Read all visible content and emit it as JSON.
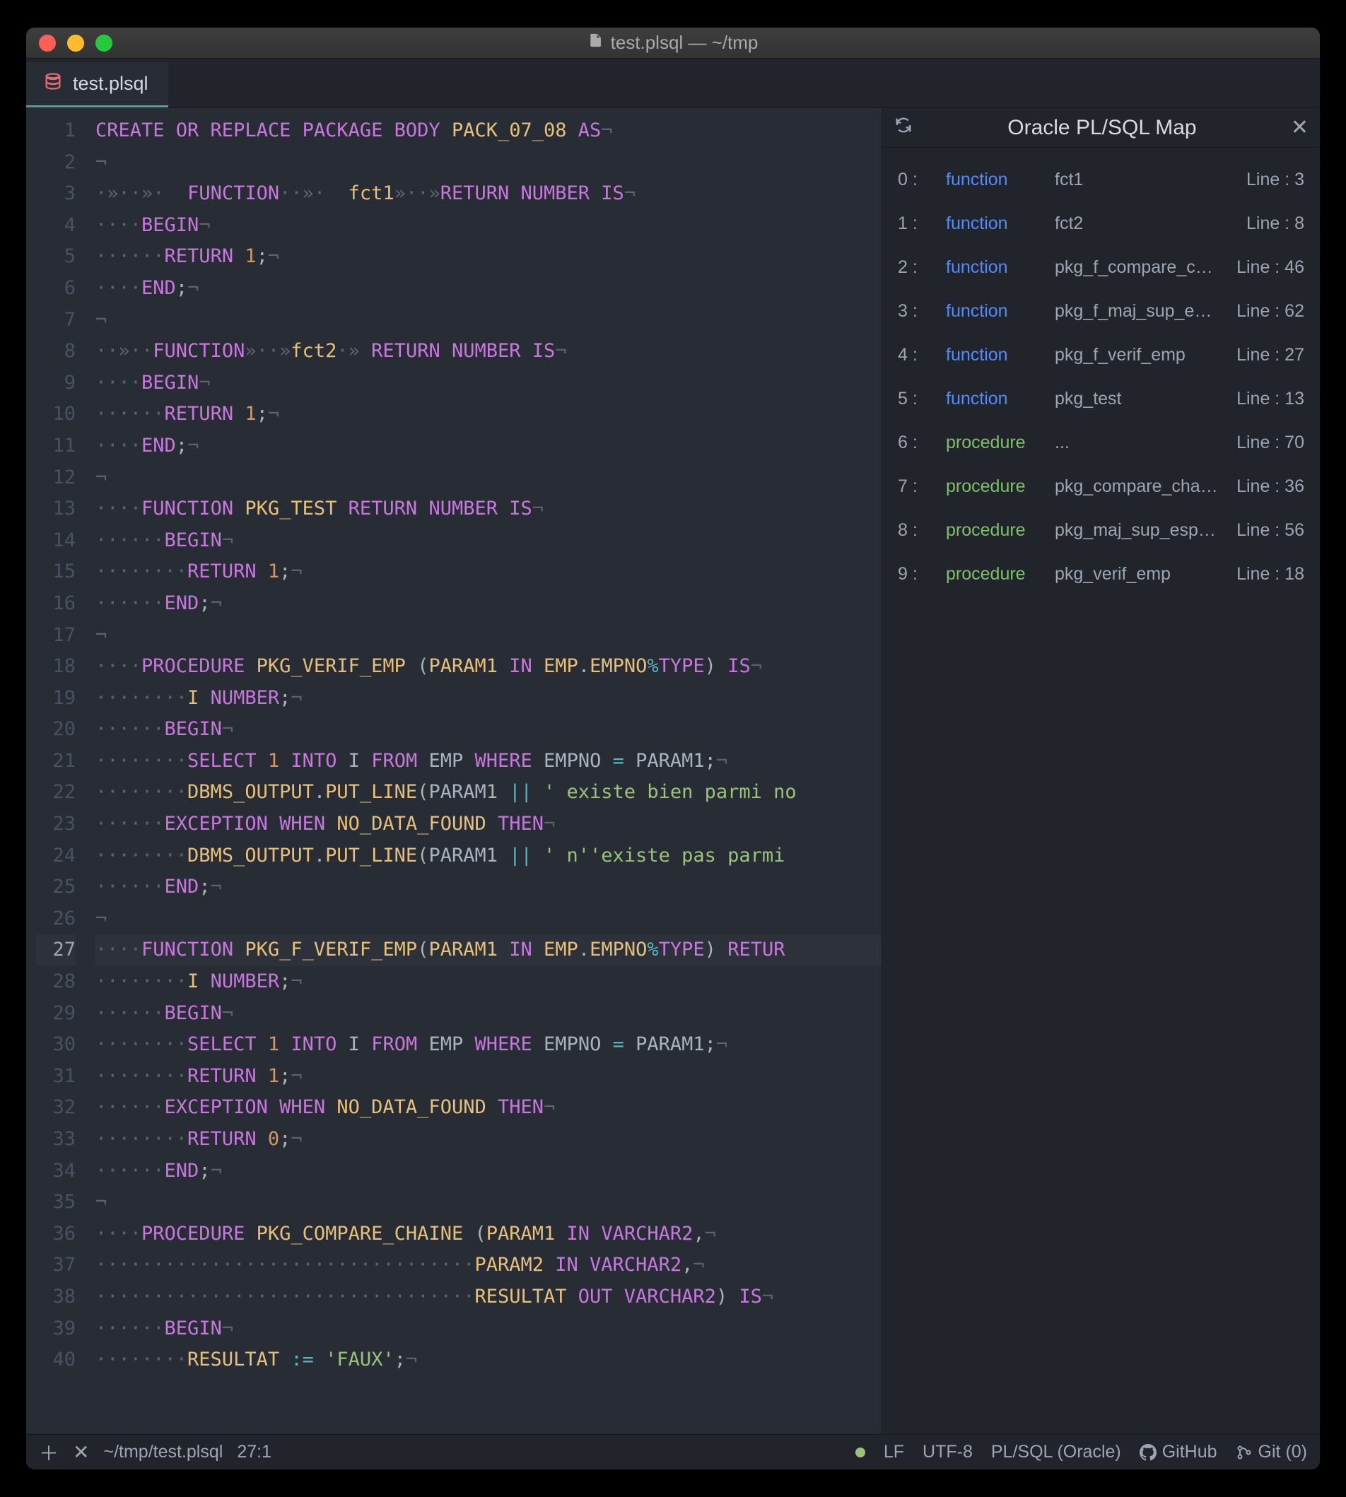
{
  "window": {
    "title": "test.plsql — ~/tmp"
  },
  "tab": {
    "name": "test.plsql"
  },
  "gutter": {
    "start": 1,
    "end": 40,
    "active": 27
  },
  "code": [
    {
      "t": [
        [
          "kw",
          "CREATE OR REPLACE PACKAGE BODY"
        ],
        [
          "plain",
          " "
        ],
        [
          "ident",
          "PACK_07_08"
        ],
        [
          "plain",
          " "
        ],
        [
          "kw",
          "AS"
        ],
        [
          "inv",
          "¬"
        ]
      ]
    },
    {
      "t": [
        [
          "inv",
          "¬"
        ]
      ]
    },
    {
      "t": [
        [
          "inv",
          "·»··»·"
        ],
        [
          "plain",
          "  "
        ],
        [
          "kw",
          "FUNCTION"
        ],
        [
          "inv",
          "··»·"
        ],
        [
          "plain",
          "  "
        ],
        [
          "ident",
          "fct1"
        ],
        [
          "inv",
          "»··»"
        ],
        [
          "kw",
          "RETURN NUMBER IS"
        ],
        [
          "inv",
          "¬"
        ]
      ]
    },
    {
      "t": [
        [
          "inv",
          "····"
        ],
        [
          "kw",
          "BEGIN"
        ],
        [
          "inv",
          "¬"
        ]
      ]
    },
    {
      "t": [
        [
          "inv",
          "······"
        ],
        [
          "kw",
          "RETURN"
        ],
        [
          "plain",
          " "
        ],
        [
          "num",
          "1"
        ],
        [
          "punct",
          ";"
        ],
        [
          "inv",
          "¬"
        ]
      ]
    },
    {
      "t": [
        [
          "inv",
          "····"
        ],
        [
          "kw",
          "END"
        ],
        [
          "punct",
          ";"
        ],
        [
          "inv",
          "¬"
        ]
      ]
    },
    {
      "t": [
        [
          "inv",
          "¬"
        ]
      ]
    },
    {
      "t": [
        [
          "inv",
          "··»··"
        ],
        [
          "kw",
          "FUNCTION"
        ],
        [
          "inv",
          "»··»"
        ],
        [
          "ident",
          "fct2"
        ],
        [
          "inv",
          "·»"
        ],
        [
          "plain",
          " "
        ],
        [
          "kw",
          "RETURN NUMBER IS"
        ],
        [
          "inv",
          "¬"
        ]
      ]
    },
    {
      "t": [
        [
          "inv",
          "····"
        ],
        [
          "kw",
          "BEGIN"
        ],
        [
          "inv",
          "¬"
        ]
      ]
    },
    {
      "t": [
        [
          "inv",
          "······"
        ],
        [
          "kw",
          "RETURN"
        ],
        [
          "plain",
          " "
        ],
        [
          "num",
          "1"
        ],
        [
          "punct",
          ";"
        ],
        [
          "inv",
          "¬"
        ]
      ]
    },
    {
      "t": [
        [
          "inv",
          "····"
        ],
        [
          "kw",
          "END"
        ],
        [
          "punct",
          ";"
        ],
        [
          "inv",
          "¬"
        ]
      ]
    },
    {
      "t": [
        [
          "inv",
          "¬"
        ]
      ]
    },
    {
      "t": [
        [
          "inv",
          "····"
        ],
        [
          "kw",
          "FUNCTION"
        ],
        [
          "plain",
          " "
        ],
        [
          "ident",
          "PKG_TEST"
        ],
        [
          "plain",
          " "
        ],
        [
          "kw",
          "RETURN NUMBER IS"
        ],
        [
          "inv",
          "¬"
        ]
      ]
    },
    {
      "t": [
        [
          "inv",
          "······"
        ],
        [
          "kw",
          "BEGIN"
        ],
        [
          "inv",
          "¬"
        ]
      ]
    },
    {
      "t": [
        [
          "inv",
          "········"
        ],
        [
          "kw",
          "RETURN"
        ],
        [
          "plain",
          " "
        ],
        [
          "num",
          "1"
        ],
        [
          "punct",
          ";"
        ],
        [
          "inv",
          "¬"
        ]
      ]
    },
    {
      "t": [
        [
          "inv",
          "······"
        ],
        [
          "kw",
          "END"
        ],
        [
          "punct",
          ";"
        ],
        [
          "inv",
          "¬"
        ]
      ]
    },
    {
      "t": [
        [
          "inv",
          "¬"
        ]
      ]
    },
    {
      "t": [
        [
          "inv",
          "····"
        ],
        [
          "kw",
          "PROCEDURE"
        ],
        [
          "plain",
          " "
        ],
        [
          "ident",
          "PKG_VERIF_EMP"
        ],
        [
          "plain",
          " ("
        ],
        [
          "ident",
          "PARAM1"
        ],
        [
          "plain",
          " "
        ],
        [
          "kw",
          "IN"
        ],
        [
          "plain",
          " "
        ],
        [
          "ident",
          "EMP"
        ],
        [
          "punct",
          "."
        ],
        [
          "ident",
          "EMPNO"
        ],
        [
          "op",
          "%"
        ],
        [
          "kw",
          "TYPE"
        ],
        [
          "punct",
          ")"
        ],
        [
          "plain",
          " "
        ],
        [
          "kw",
          "IS"
        ],
        [
          "inv",
          "¬"
        ]
      ]
    },
    {
      "t": [
        [
          "inv",
          "········"
        ],
        [
          "ident",
          "I"
        ],
        [
          "plain",
          " "
        ],
        [
          "kw",
          "NUMBER"
        ],
        [
          "punct",
          ";"
        ],
        [
          "inv",
          "¬"
        ]
      ]
    },
    {
      "t": [
        [
          "inv",
          "······"
        ],
        [
          "kw",
          "BEGIN"
        ],
        [
          "inv",
          "¬"
        ]
      ]
    },
    {
      "t": [
        [
          "inv",
          "········"
        ],
        [
          "kw",
          "SELECT"
        ],
        [
          "plain",
          " "
        ],
        [
          "num",
          "1"
        ],
        [
          "plain",
          " "
        ],
        [
          "kw",
          "INTO"
        ],
        [
          "plain",
          " I "
        ],
        [
          "kw",
          "FROM"
        ],
        [
          "plain",
          " EMP "
        ],
        [
          "kw",
          "WHERE"
        ],
        [
          "plain",
          " EMPNO "
        ],
        [
          "op",
          "="
        ],
        [
          "plain",
          " PARAM1"
        ],
        [
          "punct",
          ";"
        ],
        [
          "inv",
          "¬"
        ]
      ]
    },
    {
      "t": [
        [
          "inv",
          "········"
        ],
        [
          "ident",
          "DBMS_OUTPUT"
        ],
        [
          "punct",
          "."
        ],
        [
          "ident",
          "PUT_LINE"
        ],
        [
          "punct",
          "("
        ],
        [
          "plain",
          "PARAM1 "
        ],
        [
          "op",
          "||"
        ],
        [
          "plain",
          " "
        ],
        [
          "str",
          "' existe bien parmi no"
        ]
      ]
    },
    {
      "t": [
        [
          "inv",
          "······"
        ],
        [
          "kw",
          "EXCEPTION WHEN"
        ],
        [
          "plain",
          " "
        ],
        [
          "ident",
          "NO_DATA_FOUND"
        ],
        [
          "plain",
          " "
        ],
        [
          "kw",
          "THEN"
        ],
        [
          "inv",
          "¬"
        ]
      ]
    },
    {
      "t": [
        [
          "inv",
          "········"
        ],
        [
          "ident",
          "DBMS_OUTPUT"
        ],
        [
          "punct",
          "."
        ],
        [
          "ident",
          "PUT_LINE"
        ],
        [
          "punct",
          "("
        ],
        [
          "plain",
          "PARAM1 "
        ],
        [
          "op",
          "||"
        ],
        [
          "plain",
          " "
        ],
        [
          "str",
          "' n''existe pas parmi "
        ]
      ]
    },
    {
      "t": [
        [
          "inv",
          "······"
        ],
        [
          "kw",
          "END"
        ],
        [
          "punct",
          ";"
        ],
        [
          "inv",
          "¬"
        ]
      ]
    },
    {
      "t": [
        [
          "inv",
          "¬"
        ]
      ]
    },
    {
      "t": [
        [
          "inv",
          "····"
        ],
        [
          "kw",
          "FUNCTION"
        ],
        [
          "plain",
          " "
        ],
        [
          "ident",
          "PKG_F_VERIF_EMP"
        ],
        [
          "punct",
          "("
        ],
        [
          "ident",
          "PARAM1"
        ],
        [
          "plain",
          " "
        ],
        [
          "kw",
          "IN"
        ],
        [
          "plain",
          " "
        ],
        [
          "ident",
          "EMP"
        ],
        [
          "punct",
          "."
        ],
        [
          "ident",
          "EMPNO"
        ],
        [
          "op",
          "%"
        ],
        [
          "kw",
          "TYPE"
        ],
        [
          "punct",
          ")"
        ],
        [
          "plain",
          " "
        ],
        [
          "kw",
          "RETUR"
        ]
      ],
      "active": true
    },
    {
      "t": [
        [
          "inv",
          "········"
        ],
        [
          "ident",
          "I"
        ],
        [
          "plain",
          " "
        ],
        [
          "kw",
          "NUMBER"
        ],
        [
          "punct",
          ";"
        ],
        [
          "inv",
          "¬"
        ]
      ]
    },
    {
      "t": [
        [
          "inv",
          "······"
        ],
        [
          "kw",
          "BEGIN"
        ],
        [
          "inv",
          "¬"
        ]
      ]
    },
    {
      "t": [
        [
          "inv",
          "········"
        ],
        [
          "kw",
          "SELECT"
        ],
        [
          "plain",
          " "
        ],
        [
          "num",
          "1"
        ],
        [
          "plain",
          " "
        ],
        [
          "kw",
          "INTO"
        ],
        [
          "plain",
          " I "
        ],
        [
          "kw",
          "FROM"
        ],
        [
          "plain",
          " EMP "
        ],
        [
          "kw",
          "WHERE"
        ],
        [
          "plain",
          " EMPNO "
        ],
        [
          "op",
          "="
        ],
        [
          "plain",
          " PARAM1"
        ],
        [
          "punct",
          ";"
        ],
        [
          "inv",
          "¬"
        ]
      ]
    },
    {
      "t": [
        [
          "inv",
          "········"
        ],
        [
          "kw",
          "RETURN"
        ],
        [
          "plain",
          " "
        ],
        [
          "num",
          "1"
        ],
        [
          "punct",
          ";"
        ],
        [
          "inv",
          "¬"
        ]
      ]
    },
    {
      "t": [
        [
          "inv",
          "······"
        ],
        [
          "kw",
          "EXCEPTION WHEN"
        ],
        [
          "plain",
          " "
        ],
        [
          "ident",
          "NO_DATA_FOUND"
        ],
        [
          "plain",
          " "
        ],
        [
          "kw",
          "THEN"
        ],
        [
          "inv",
          "¬"
        ]
      ]
    },
    {
      "t": [
        [
          "inv",
          "········"
        ],
        [
          "kw",
          "RETURN"
        ],
        [
          "plain",
          " "
        ],
        [
          "num",
          "0"
        ],
        [
          "punct",
          ";"
        ],
        [
          "inv",
          "¬"
        ]
      ]
    },
    {
      "t": [
        [
          "inv",
          "······"
        ],
        [
          "kw",
          "END"
        ],
        [
          "punct",
          ";"
        ],
        [
          "inv",
          "¬"
        ]
      ]
    },
    {
      "t": [
        [
          "inv",
          "¬"
        ]
      ]
    },
    {
      "t": [
        [
          "inv",
          "····"
        ],
        [
          "kw",
          "PROCEDURE"
        ],
        [
          "plain",
          " "
        ],
        [
          "ident",
          "PKG_COMPARE_CHAINE"
        ],
        [
          "plain",
          " ("
        ],
        [
          "ident",
          "PARAM1"
        ],
        [
          "plain",
          " "
        ],
        [
          "kw",
          "IN"
        ],
        [
          "plain",
          " "
        ],
        [
          "kw",
          "VARCHAR2"
        ],
        [
          "punct",
          ","
        ],
        [
          "inv",
          "¬"
        ]
      ]
    },
    {
      "t": [
        [
          "inv",
          "·································"
        ],
        [
          "ident",
          "PARAM2"
        ],
        [
          "plain",
          " "
        ],
        [
          "kw",
          "IN"
        ],
        [
          "plain",
          " "
        ],
        [
          "kw",
          "VARCHAR2"
        ],
        [
          "punct",
          ","
        ],
        [
          "inv",
          "¬"
        ]
      ]
    },
    {
      "t": [
        [
          "inv",
          "·································"
        ],
        [
          "ident",
          "RESULTAT"
        ],
        [
          "plain",
          " "
        ],
        [
          "kw",
          "OUT"
        ],
        [
          "plain",
          " "
        ],
        [
          "kw",
          "VARCHAR2"
        ],
        [
          "punct",
          ")"
        ],
        [
          "plain",
          " "
        ],
        [
          "kw",
          "IS"
        ],
        [
          "inv",
          "¬"
        ]
      ]
    },
    {
      "t": [
        [
          "inv",
          "······"
        ],
        [
          "kw",
          "BEGIN"
        ],
        [
          "inv",
          "¬"
        ]
      ]
    },
    {
      "t": [
        [
          "inv",
          "········"
        ],
        [
          "ident",
          "RESULTAT"
        ],
        [
          "plain",
          " "
        ],
        [
          "op",
          ":="
        ],
        [
          "plain",
          " "
        ],
        [
          "str",
          "'FAUX'"
        ],
        [
          "punct",
          ";"
        ],
        [
          "inv",
          "¬"
        ]
      ]
    }
  ],
  "map": {
    "title": "Oracle PL/SQL Map",
    "rows": [
      {
        "idx": "0 :",
        "kind": "function",
        "kindcls": "func",
        "name": "fct1",
        "line": "Line : 3"
      },
      {
        "idx": "1 :",
        "kind": "function",
        "kindcls": "func",
        "name": "fct2",
        "line": "Line : 8"
      },
      {
        "idx": "2 :",
        "kind": "function",
        "kindcls": "func",
        "name": "pkg_f_compare_chaine",
        "line": "Line : 46"
      },
      {
        "idx": "3 :",
        "kind": "function",
        "kindcls": "func",
        "name": "pkg_f_maj_sup_esp_ch",
        "line": "Line : 62"
      },
      {
        "idx": "4 :",
        "kind": "function",
        "kindcls": "func",
        "name": "pkg_f_verif_emp",
        "line": "Line : 27"
      },
      {
        "idx": "5 :",
        "kind": "function",
        "kindcls": "func",
        "name": "pkg_test",
        "line": "Line : 13"
      },
      {
        "idx": "6 :",
        "kind": "procedure",
        "kindcls": "proc",
        "name": "...",
        "line": "Line : 70"
      },
      {
        "idx": "7 :",
        "kind": "procedure",
        "kindcls": "proc",
        "name": "pkg_compare_chaine",
        "line": "Line : 36"
      },
      {
        "idx": "8 :",
        "kind": "procedure",
        "kindcls": "proc",
        "name": "pkg_maj_sup_esp_ch",
        "line": "Line : 56"
      },
      {
        "idx": "9 :",
        "kind": "procedure",
        "kindcls": "proc",
        "name": "pkg_verif_emp",
        "line": "Line : 18"
      }
    ]
  },
  "status": {
    "file": "~/tmp/test.plsql",
    "cursor": "27:1",
    "eol": "LF",
    "encoding": "UTF-8",
    "lang": "PL/SQL (Oracle)",
    "github": "GitHub",
    "git": "Git (0)"
  }
}
